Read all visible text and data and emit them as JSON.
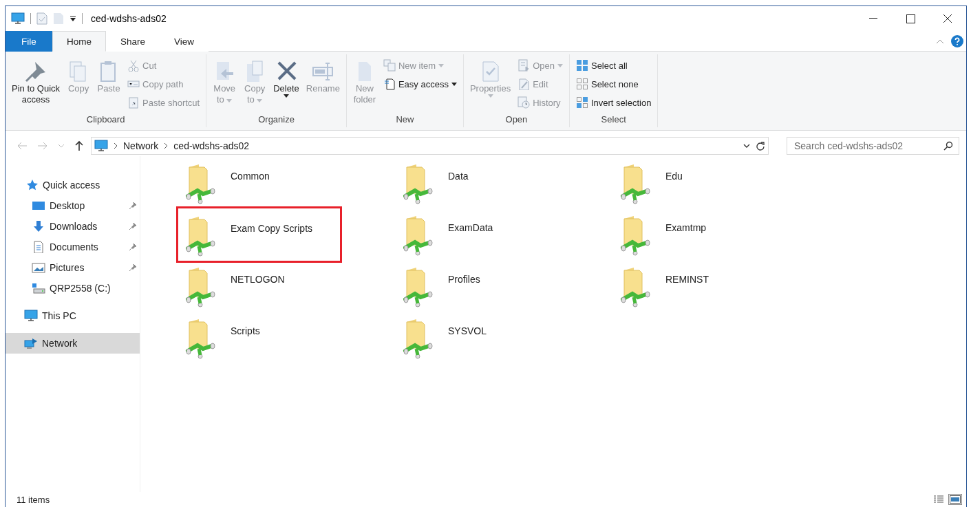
{
  "window": {
    "title": "ced-wdshs-ads02"
  },
  "ribbon_tabs": [
    {
      "label": "File",
      "kind": "file",
      "selected": false
    },
    {
      "label": "Home",
      "kind": "tab",
      "selected": true
    },
    {
      "label": "Share",
      "kind": "tab",
      "selected": false
    },
    {
      "label": "View",
      "kind": "tab",
      "selected": false
    }
  ],
  "ribbon_groups": [
    {
      "label": "Clipboard",
      "commands": [
        {
          "kind": "large",
          "label": "Pin to Quick\naccess",
          "disabled": false,
          "dropdown": false
        },
        {
          "kind": "large",
          "label": "Copy",
          "disabled": true,
          "dropdown": false
        },
        {
          "kind": "large",
          "label": "Paste",
          "disabled": true,
          "dropdown": false
        },
        {
          "kind": "small",
          "label": "Cut",
          "disabled": true,
          "dropdown": false
        },
        {
          "kind": "small",
          "label": "Copy path",
          "disabled": true,
          "dropdown": false
        },
        {
          "kind": "small",
          "label": "Paste shortcut",
          "disabled": true,
          "dropdown": false
        }
      ]
    },
    {
      "label": "Organize",
      "commands": [
        {
          "kind": "large",
          "label": "Move\nto",
          "disabled": true,
          "dropdown": true
        },
        {
          "kind": "large",
          "label": "Copy\nto",
          "disabled": true,
          "dropdown": true
        },
        {
          "kind": "large",
          "label": "Delete",
          "disabled": false,
          "dropdown": true
        },
        {
          "kind": "large",
          "label": "Rename",
          "disabled": true,
          "dropdown": false
        }
      ]
    },
    {
      "label": "New",
      "commands": [
        {
          "kind": "large",
          "label": "New\nfolder",
          "disabled": true,
          "dropdown": false
        },
        {
          "kind": "small",
          "label": "New item",
          "disabled": true,
          "dropdown": true
        },
        {
          "kind": "small",
          "label": "Easy access",
          "disabled": false,
          "dropdown": true
        }
      ]
    },
    {
      "label": "Open",
      "commands": [
        {
          "kind": "large",
          "label": "Properties",
          "disabled": true,
          "dropdown": true
        },
        {
          "kind": "small",
          "label": "Open",
          "disabled": true,
          "dropdown": true
        },
        {
          "kind": "small",
          "label": "Edit",
          "disabled": true,
          "dropdown": false
        },
        {
          "kind": "small",
          "label": "History",
          "disabled": true,
          "dropdown": false
        }
      ]
    },
    {
      "label": "Select",
      "commands": [
        {
          "kind": "small",
          "label": "Select all",
          "disabled": false,
          "dropdown": false
        },
        {
          "kind": "small",
          "label": "Select none",
          "disabled": false,
          "dropdown": false
        },
        {
          "kind": "small",
          "label": "Invert selection",
          "disabled": false,
          "dropdown": false
        }
      ]
    }
  ],
  "address_bar": {
    "breadcrumbs": [
      "Network",
      "ced-wdshs-ads02"
    ]
  },
  "search": {
    "placeholder": "Search ced-wdshs-ads02"
  },
  "sidebar": {
    "items": [
      {
        "label": "Quick access",
        "selected": false,
        "children": [
          {
            "label": "Desktop",
            "pinned": true,
            "selected": false
          },
          {
            "label": "Downloads",
            "pinned": true,
            "selected": false
          },
          {
            "label": "Documents",
            "pinned": true,
            "selected": false
          },
          {
            "label": "Pictures",
            "pinned": true,
            "selected": false
          },
          {
            "label": "QRP2558 (C:)",
            "pinned": false,
            "selected": false
          }
        ]
      },
      {
        "label": "This PC",
        "selected": false
      },
      {
        "label": "Network",
        "selected": true
      }
    ]
  },
  "folders": [
    {
      "name": "Common",
      "highlighted": false
    },
    {
      "name": "Data",
      "highlighted": false
    },
    {
      "name": "Edu",
      "highlighted": false
    },
    {
      "name": "Exam Copy Scripts",
      "highlighted": true
    },
    {
      "name": "ExamData",
      "highlighted": false
    },
    {
      "name": "Examtmp",
      "highlighted": false
    },
    {
      "name": "NETLOGON",
      "highlighted": false
    },
    {
      "name": "Profiles",
      "highlighted": false
    },
    {
      "name": "REMINST",
      "highlighted": false
    },
    {
      "name": "Scripts",
      "highlighted": false
    },
    {
      "name": "SYSVOL",
      "highlighted": false
    }
  ],
  "status_bar": {
    "item_count": "11 items",
    "views": [
      {
        "selected": false
      },
      {
        "selected": true
      }
    ]
  }
}
